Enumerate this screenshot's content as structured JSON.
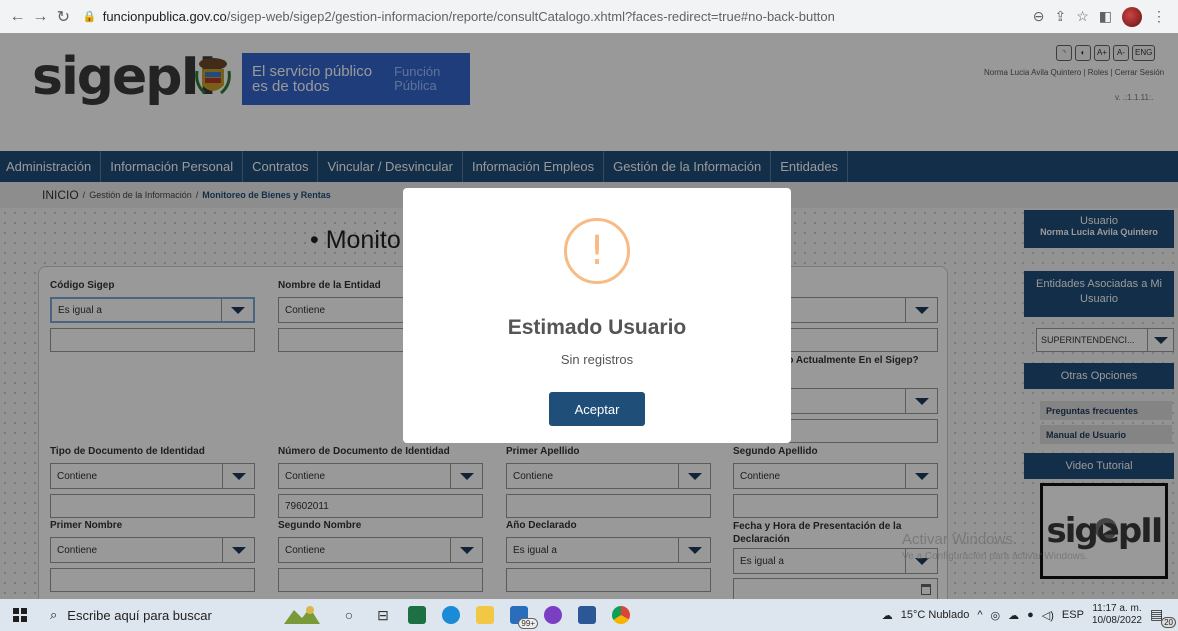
{
  "browser": {
    "url_host": "funcionpublica.gov.co",
    "url_path": "/sigep-web/sigep2/gestion-informacion/reporte/consultCatalogo.xhtml?faces-redirect=true#no-back-button"
  },
  "header": {
    "logo_text": "sigepII",
    "banner_line1a": "El servicio público",
    "banner_line1b": "es de todos",
    "banner_line2a": "Función",
    "banner_line2b": "Pública",
    "tools": [
      "A+",
      "A-",
      "ENG"
    ],
    "user_links": "Norma Lucia Avila Quintero | Roles | Cerrar Sesión",
    "version": "v. .:1.1.11:."
  },
  "menu": [
    "Administración",
    "Información Personal",
    "Contratos",
    "Vincular / Desvincular",
    "Información Empleos",
    "Gestión de la Información",
    "Entidades"
  ],
  "breadcrumb": {
    "home": "INICIO",
    "sep1": "/",
    "level1": "Gestión de la Información",
    "sep2": "/",
    "current": "Monitoreo de Bienes y Rentas"
  },
  "main": {
    "title": "• Monito"
  },
  "filters": {
    "codigo_label": "Código Sigep",
    "codigo_select": "Es igual a",
    "entidad_label": "Nombre de la Entidad",
    "entidad_select": "Contiene",
    "col4_label": "a",
    "activo_label": "ivo Actualmente En el Sigep?",
    "tipo_doc_label": "Tipo de Documento de Identidad",
    "tipo_doc_select": "Contiene",
    "num_doc_label": "Número de Documento de Identidad",
    "num_doc_select": "Contiene",
    "num_doc_value": "79602011",
    "apellido1_label": "Primer Apellido",
    "apellido1_select": "Contiene",
    "apellido2_label": "Segundo Apellido",
    "apellido2_select": "Contiene",
    "nombre1_label": "Primer Nombre",
    "nombre1_select": "Contiene",
    "nombre2_label": "Segundo Nombre",
    "nombre2_select": "Contiene",
    "anio_label": "Año Declarado",
    "anio_select": "Es igual a",
    "fecha_label": "Fecha y Hora de Presentación de la Declaración",
    "fecha_select": "Es igual a"
  },
  "sidebar": {
    "usuario_title": "Usuario",
    "usuario_name": "Norma Lucia Avila Quintero",
    "entidades_title": "Entidades Asociadas a Mi Usuario",
    "entidad_select": "SUPERINTENDENCI...",
    "otras_title": "Otras Opciones",
    "link1": "Preguntas frecuentes",
    "link2": "Manual de Usuario",
    "video_title": "Video Tutorial",
    "video_logo": "sigepII"
  },
  "watermark": {
    "line1": "Activar Windows",
    "line2": "Ve a Configuración para activar Windows."
  },
  "modal": {
    "icon": "!",
    "title": "Estimado Usuario",
    "text": "Sin registros",
    "button": "Aceptar"
  },
  "taskbar": {
    "search_placeholder": "Escribe aquí para buscar",
    "mail_badge": "99+",
    "weather": "15°C  Nublado",
    "lang": "ESP",
    "time": "11:17 a. m.",
    "date": "10/08/2022",
    "notifications": "20"
  }
}
